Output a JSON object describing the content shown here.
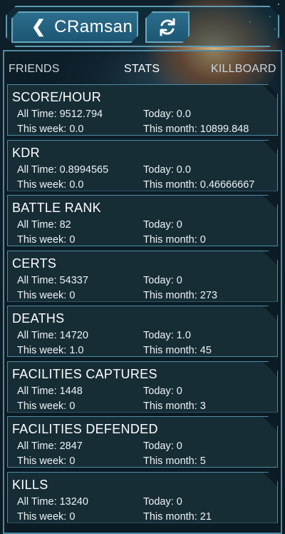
{
  "header": {
    "back_label": "CRamsan",
    "back_icon": "chevron-left-icon",
    "refresh_icon": "refresh-icon"
  },
  "tabs": [
    {
      "label": "FRIENDS"
    },
    {
      "label": "STATS",
      "active": true
    },
    {
      "label": "KILLBOARD"
    }
  ],
  "stats": [
    {
      "title": "SCORE/HOUR",
      "all_time": "9512.794",
      "today": "0.0",
      "week": "0.0",
      "month": "10899.848"
    },
    {
      "title": "KDR",
      "all_time": "0.8994565",
      "today": "0.0",
      "week": "0.0",
      "month": "0.46666667"
    },
    {
      "title": "BATTLE RANK",
      "all_time": "82",
      "today": "0",
      "week": "0",
      "month": "0"
    },
    {
      "title": "CERTS",
      "all_time": "54337",
      "today": "0",
      "week": "0",
      "month": "273"
    },
    {
      "title": "DEATHS",
      "all_time": "14720",
      "today": "1.0",
      "week": "1.0",
      "month": "45"
    },
    {
      "title": "FACILITIES CAPTURES",
      "all_time": "1448",
      "today": "0",
      "week": "0",
      "month": "3"
    },
    {
      "title": "FACILITIES DEFENDED",
      "all_time": "2847",
      "today": "0",
      "week": "0",
      "month": "5"
    },
    {
      "title": "KILLS",
      "all_time": "13240",
      "today": "0",
      "week": "0",
      "month": "21"
    }
  ],
  "labels": {
    "all_time": "All Time:",
    "today": "Today:",
    "week": "This week:",
    "month": "This month:"
  },
  "colors": {
    "accent": "#5d99b2",
    "button": "#2a6e8c",
    "card": "#172d36",
    "background": "#0c1c24"
  }
}
